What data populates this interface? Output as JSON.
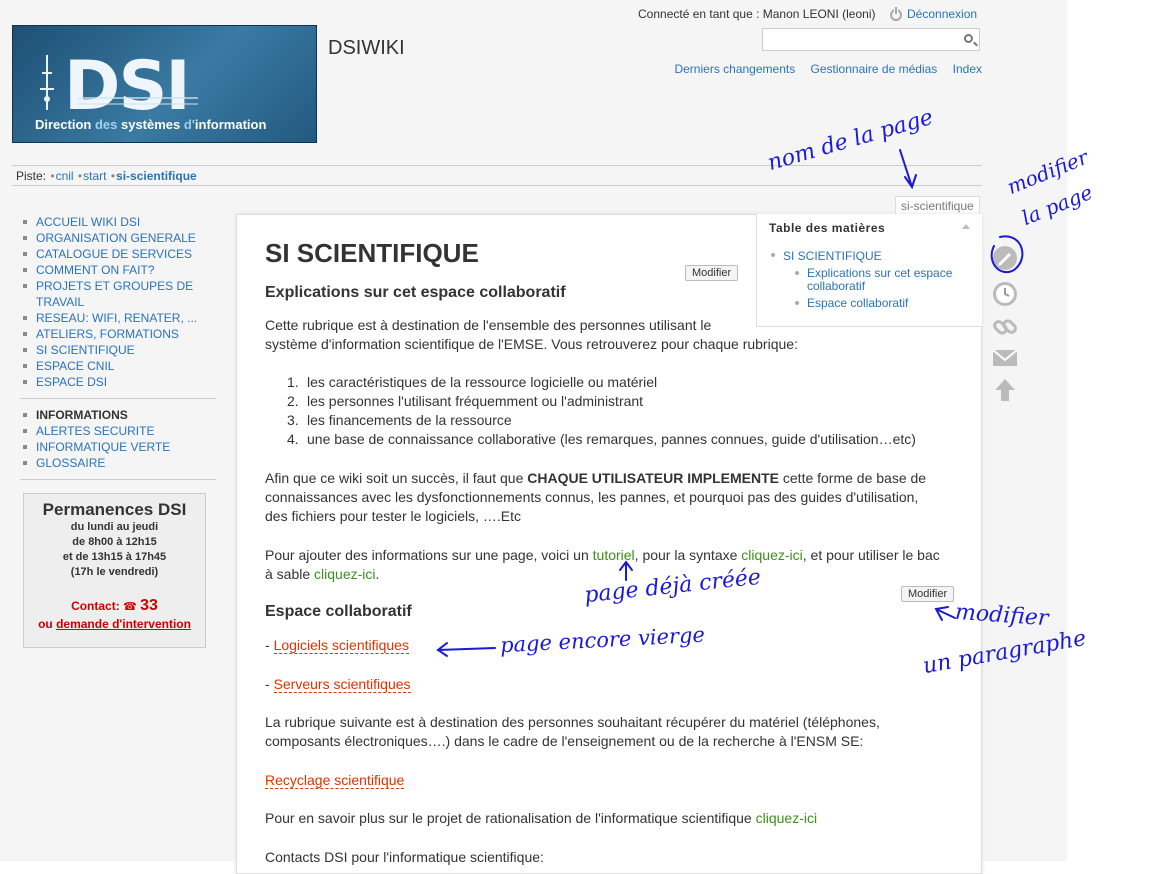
{
  "header": {
    "site_title": "DSIWIKI",
    "logo_text": "DSI",
    "logo_tagline_a": "Direction ",
    "logo_tagline_b": "des ",
    "logo_tagline_c": "systèmes ",
    "logo_tagline_d": "d'",
    "logo_tagline_e": "information",
    "user_line": "Connecté en tant que : Manon LEONI (leoni)",
    "logout_label": "Déconnexion",
    "search_value": "",
    "links": [
      "Derniers changements",
      "Gestionnaire de médias",
      "Index"
    ]
  },
  "breadcrumb": {
    "label": "Piste:",
    "items": [
      "cnil",
      "start",
      "si-scientifique"
    ]
  },
  "sidebar": {
    "group1": [
      "ACCUEIL WIKI DSI",
      "ORGANISATION GENERALE",
      "CATALOGUE DE SERVICES",
      "COMMENT ON FAIT?",
      "PROJETS ET GROUPES DE TRAVAIL",
      "RESEAU: WIFI, RENATER, ...",
      "ATELIERS, FORMATIONS",
      "SI SCIENTIFIQUE",
      "ESPACE CNIL",
      "ESPACE DSI"
    ],
    "group2_title": "INFORMATIONS",
    "group2": [
      "ALERTES SECURITE",
      "INFORMATIQUE VERTE",
      "GLOSSAIRE"
    ]
  },
  "permanences": {
    "title": "Permanences DSI",
    "lines": [
      "du lundi au jeudi",
      "de 8h00 à 12h15",
      "et de 13h15 à 17h45",
      "(17h le vendredi)"
    ],
    "contact_label": "Contact:",
    "contact_number": "33",
    "request_prefix": "ou ",
    "request_link": "demande d'intervention"
  },
  "page": {
    "tab_name": "si-scientifique",
    "title": "SI SCIENTIFIQUE",
    "edit_label": "Modifier",
    "toc": {
      "title": "Table des matières",
      "items": [
        {
          "label": "SI SCIENTIFIQUE",
          "level": 1
        },
        {
          "label": "Explications sur cet espace collaboratif",
          "level": 2
        },
        {
          "label": "Espace collaboratif",
          "level": 2
        }
      ]
    },
    "section1_title": "Explications sur cet espace collaboratif",
    "intro_1": "Cette rubrique est à destination de l'ensemble des personnes utilisant le",
    "intro_2": "système d'information scientifique de l'EMSE. Vous retrouverez pour chaque rubrique:",
    "list": [
      "les caractéristiques de la ressource logicielle ou matériel",
      "les personnes l'utilisant fréquemment ou l'administrant",
      "les financements de la ressource",
      "une base de connaissance collaborative (les remarques, pannes connues, guide d'utilisation…etc)"
    ],
    "para2_a": "Afin que ce wiki soit un succès, il faut que ",
    "para2_b": "CHAQUE UTILISATEUR IMPLEMENTE",
    "para2_c": " cette forme de base de",
    "para2_line2": "connaissances avec les dysfonctionnements connus, les pannes, et pourquoi pas des guides d'utilisation,",
    "para2_line3": "des fichiers pour tester le logiciels, ….Etc",
    "para3_a": "Pour ajouter des informations sur une page, voici un ",
    "para3_link1": "tutoriel",
    "para3_b": ", pour la syntaxe ",
    "para3_link2": "cliquez-ici",
    "para3_c": ", et pour utiliser le bac",
    "para3_d": "à sable ",
    "para3_link3": "cliquez-ici",
    "para3_e": ".",
    "section2_title": "Espace collaboratif",
    "dash": "- ",
    "wanted1": "Logiciels scientifiques",
    "wanted2": "Serveurs scientifiques",
    "para4_line1": "La rubrique suivante est à destination des personnes souhaitant récupérer du matériel (téléphones,",
    "para4_line2": "composants électroniques….) dans le cadre de l'enseignement ou de la recherche à l'ENSM SE:",
    "wanted3": "Recyclage scientifique",
    "para5_a": "Pour en savoir plus sur le projet de rationalisation de l'informatique scientifique ",
    "para5_link": "cliquez-ici",
    "para6": "Contacts DSI pour l'informatique scientifique:"
  },
  "annotations": {
    "nom_page": "nom de la page",
    "modifier_page_1": "modifier",
    "modifier_page_2": "la page",
    "deja_creee": "page déjà créée",
    "encore_vierge": "page encore vierge",
    "modifier_para_1": "modifier",
    "modifier_para_2": "un paragraphe"
  },
  "colors": {
    "link": "#2b73b7",
    "external_link": "#3b8f1a",
    "wanted_link": "#dd3300",
    "annotation": "#1a1ad6"
  }
}
